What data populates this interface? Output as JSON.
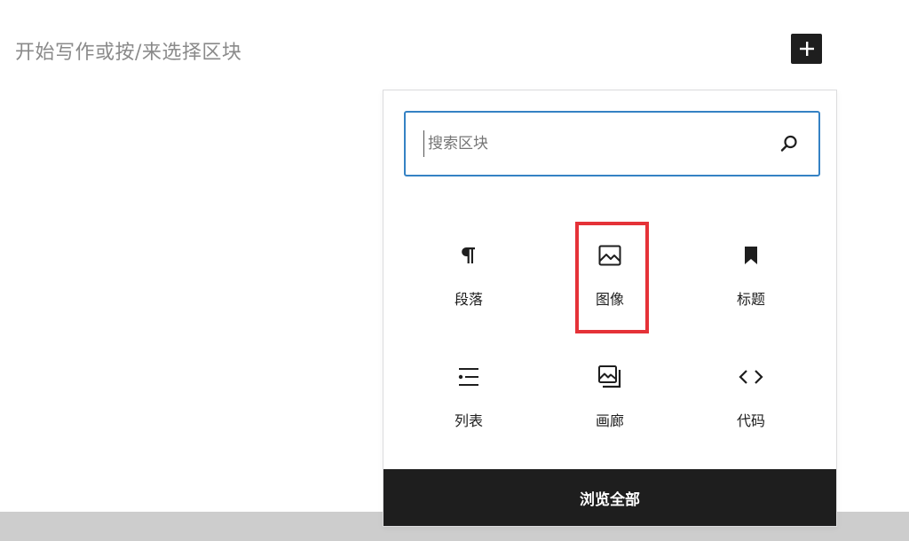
{
  "editor": {
    "placeholder": "开始写作或按/来选择区块"
  },
  "toolbar": {
    "add_block_icon": "plus-icon"
  },
  "inserter": {
    "search_placeholder": "搜索区块",
    "search_value": "",
    "blocks": [
      {
        "label": "段落",
        "icon": "paragraph-icon"
      },
      {
        "label": "图像",
        "icon": "image-icon"
      },
      {
        "label": "标题",
        "icon": "bookmark-icon"
      },
      {
        "label": "列表",
        "icon": "list-icon"
      },
      {
        "label": "画廊",
        "icon": "gallery-icon"
      },
      {
        "label": "代码",
        "icon": "code-icon"
      }
    ],
    "browse_all_label": "浏览全部",
    "highlight_color": "#e53238",
    "accent_color": "#3582c4"
  }
}
